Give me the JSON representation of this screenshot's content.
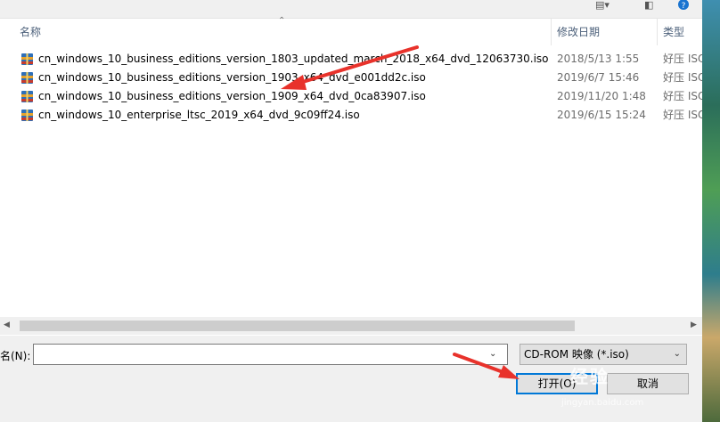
{
  "columns": {
    "name": "名称",
    "modified": "修改日期",
    "type": "类型"
  },
  "files": [
    {
      "name": "cn_windows_10_business_editions_version_1803_updated_march_2018_x64_dvd_12063730.iso",
      "modified": "2018/5/13 1:55",
      "type": "好压 ISO"
    },
    {
      "name": "cn_windows_10_business_editions_version_1903_x64_dvd_e001dd2c.iso",
      "modified": "2019/6/7 15:46",
      "type": "好压 ISO"
    },
    {
      "name": "cn_windows_10_business_editions_version_1909_x64_dvd_0ca83907.iso",
      "modified": "2019/11/20 1:48",
      "type": "好压 ISO"
    },
    {
      "name": "cn_windows_10_enterprise_ltsc_2019_x64_dvd_9c09ff24.iso",
      "modified": "2019/6/15 15:24",
      "type": "好压 ISO"
    }
  ],
  "file_name_label": "名(N):",
  "file_name_value": "",
  "file_type_value": "CD-ROM 映像 (*.iso)",
  "open_button": "打开(O)",
  "cancel_button": "取消",
  "watermark": {
    "text": "经验",
    "url": "jingyan.baidu.com"
  },
  "colors": {
    "accent": "#0078d7",
    "arrow": "#e8322b",
    "header_text": "#4c607a"
  }
}
